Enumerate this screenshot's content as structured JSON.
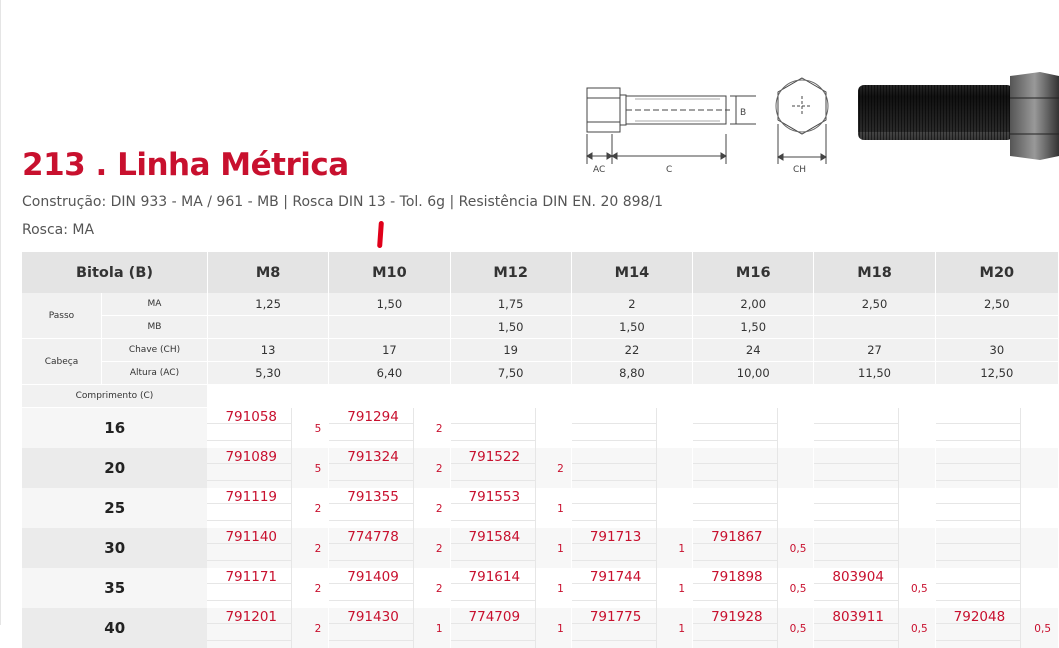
{
  "header": {
    "title": "213 . Linha Métrica",
    "subtitle": "Construção: DIN 933 - MA / 961 - MB | Rosca DIN 13 - Tol. 6g | Resistência DIN EN. 20 898/1",
    "rosca": "Rosca: MA"
  },
  "diagram": {
    "label_b": "B",
    "label_ac": "AC",
    "label_c": "C",
    "label_ch": "CH"
  },
  "table": {
    "bitola_label": "Bitola (B)",
    "sizes": [
      "M8",
      "M10",
      "M12",
      "M14",
      "M16",
      "M18",
      "M20"
    ],
    "passo_label": "Passo",
    "cabeca_label": "Cabeça",
    "ma_label": "MA",
    "mb_label": "MB",
    "chave_label": "Chave (CH)",
    "altura_label": "Altura (AC)",
    "comprimento_label": "Comprimento (C)",
    "passo_ma": [
      "1,25",
      "1,50",
      "1,75",
      "2",
      "2,00",
      "2,50",
      "2,50"
    ],
    "passo_mb": [
      "",
      "",
      "1,50",
      "1,50",
      "1,50",
      "",
      ""
    ],
    "chave": [
      "13",
      "17",
      "19",
      "22",
      "24",
      "27",
      "30"
    ],
    "altura": [
      "5,30",
      "6,40",
      "7,50",
      "8,80",
      "10,00",
      "11,50",
      "12,50"
    ],
    "lengths": [
      {
        "length": "16",
        "cells": [
          {
            "code": "791058",
            "qty": "5"
          },
          {
            "code": "791294",
            "qty": "2"
          },
          {
            "code": "",
            "qty": ""
          },
          {
            "code": "",
            "qty": ""
          },
          {
            "code": "",
            "qty": ""
          },
          {
            "code": "",
            "qty": ""
          },
          {
            "code": "",
            "qty": ""
          }
        ]
      },
      {
        "length": "20",
        "cells": [
          {
            "code": "791089",
            "qty": "5"
          },
          {
            "code": "791324",
            "qty": "2"
          },
          {
            "code": "791522",
            "qty": "2"
          },
          {
            "code": "",
            "qty": ""
          },
          {
            "code": "",
            "qty": ""
          },
          {
            "code": "",
            "qty": ""
          },
          {
            "code": "",
            "qty": ""
          }
        ]
      },
      {
        "length": "25",
        "cells": [
          {
            "code": "791119",
            "qty": "2"
          },
          {
            "code": "791355",
            "qty": "2"
          },
          {
            "code": "791553",
            "qty": "1"
          },
          {
            "code": "",
            "qty": ""
          },
          {
            "code": "",
            "qty": ""
          },
          {
            "code": "",
            "qty": ""
          },
          {
            "code": "",
            "qty": ""
          }
        ]
      },
      {
        "length": "30",
        "cells": [
          {
            "code": "791140",
            "qty": "2"
          },
          {
            "code": "774778",
            "qty": "2"
          },
          {
            "code": "791584",
            "qty": "1"
          },
          {
            "code": "791713",
            "qty": "1"
          },
          {
            "code": "791867",
            "qty": "0,5"
          },
          {
            "code": "",
            "qty": ""
          },
          {
            "code": "",
            "qty": ""
          }
        ]
      },
      {
        "length": "35",
        "cells": [
          {
            "code": "791171",
            "qty": "2"
          },
          {
            "code": "791409",
            "qty": "2"
          },
          {
            "code": "791614",
            "qty": "1"
          },
          {
            "code": "791744",
            "qty": "1"
          },
          {
            "code": "791898",
            "qty": "0,5"
          },
          {
            "code": "803904",
            "qty": "0,5"
          },
          {
            "code": "",
            "qty": ""
          }
        ]
      },
      {
        "length": "40",
        "cells": [
          {
            "code": "791201",
            "qty": "2"
          },
          {
            "code": "791430",
            "qty": "1"
          },
          {
            "code": "774709",
            "qty": "1"
          },
          {
            "code": "791775",
            "qty": "1"
          },
          {
            "code": "791928",
            "qty": "0,5"
          },
          {
            "code": "803911",
            "qty": "0,5"
          },
          {
            "code": "792048",
            "qty": "0,5"
          }
        ]
      }
    ]
  }
}
